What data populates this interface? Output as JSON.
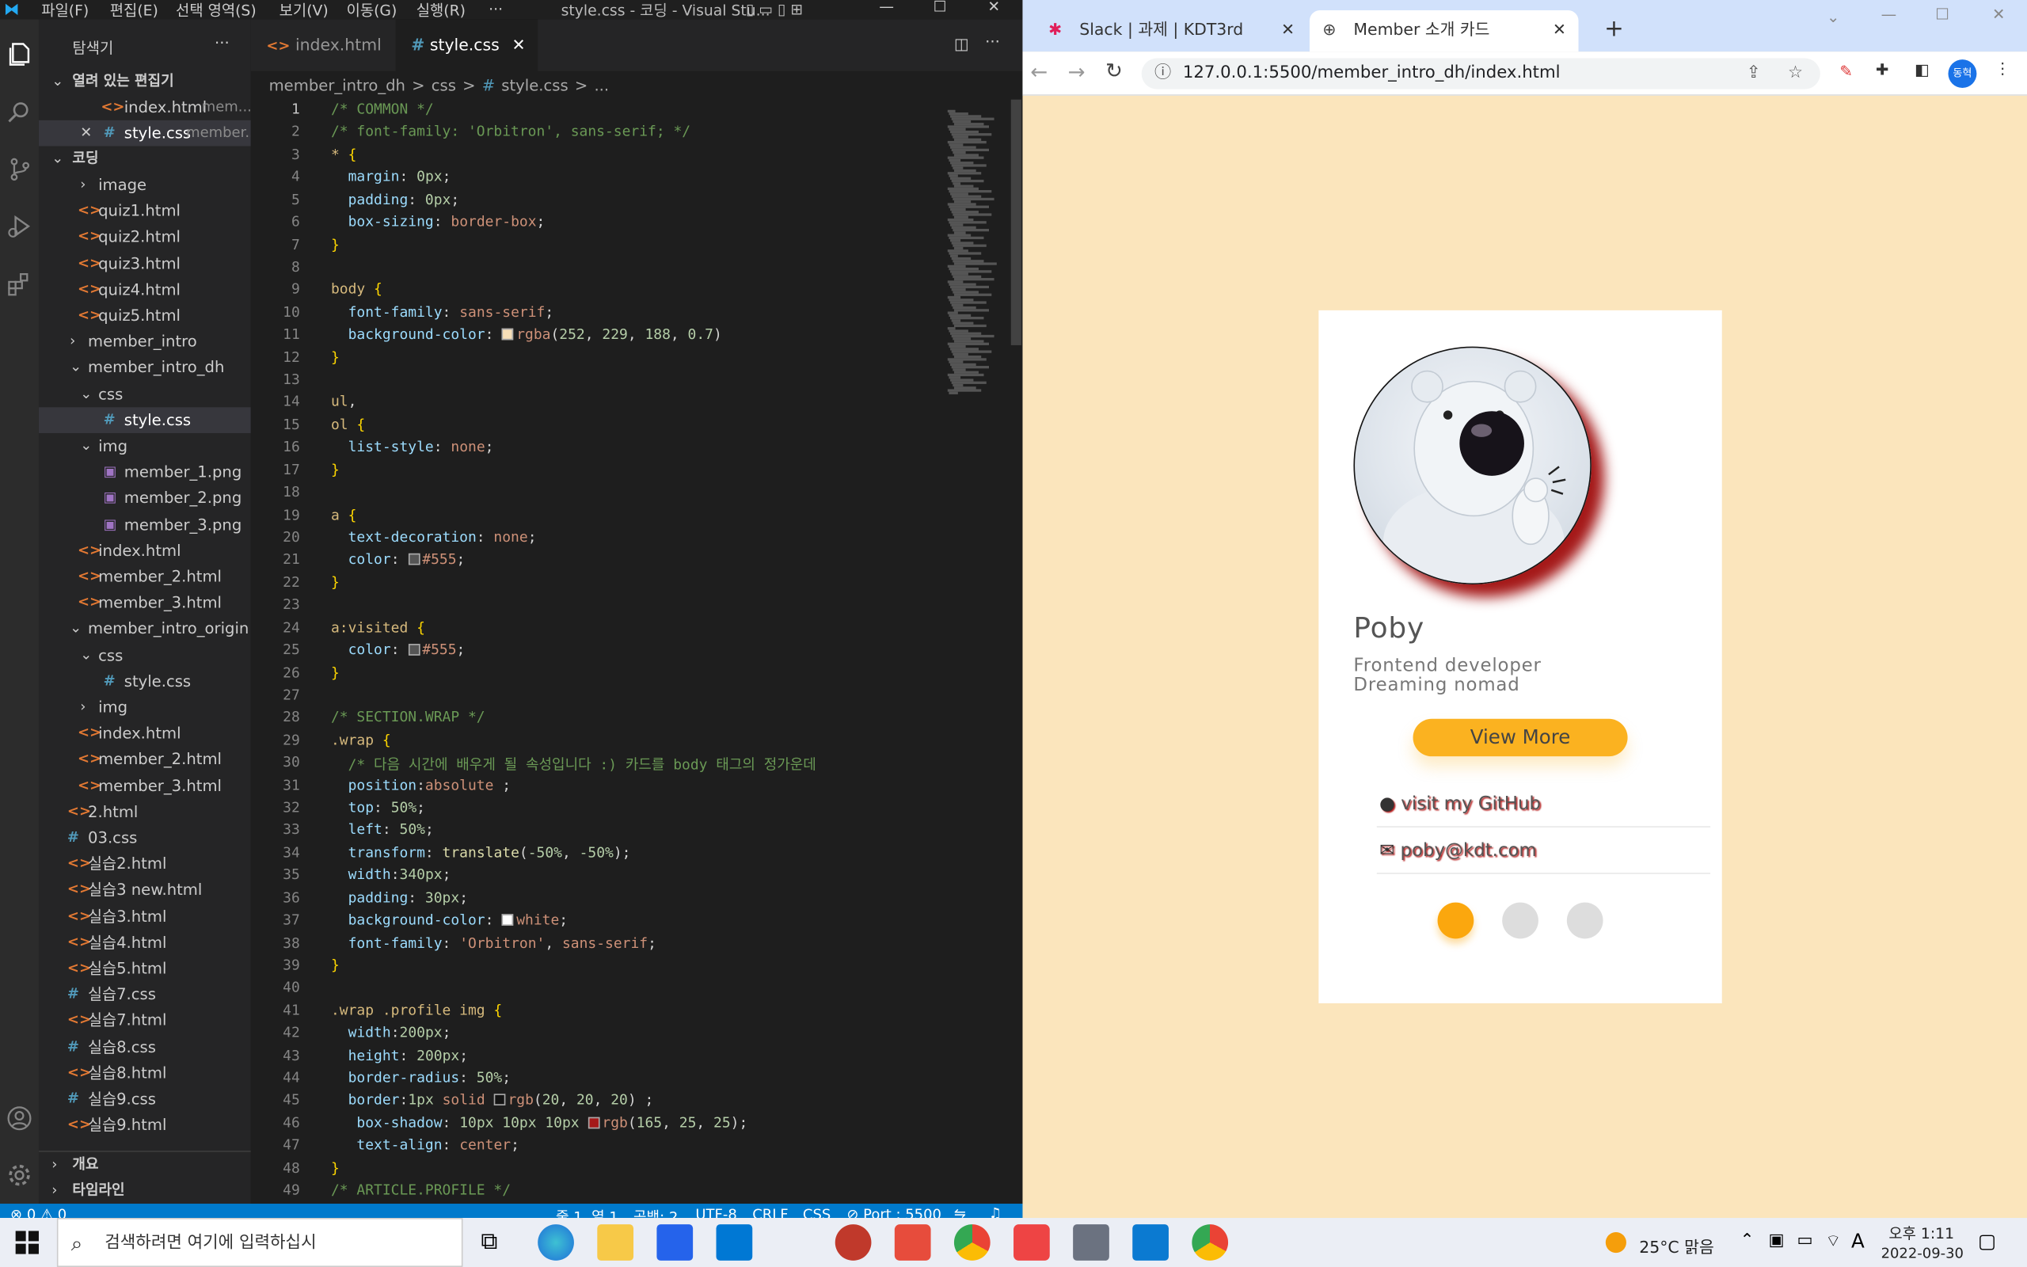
{
  "vscode": {
    "title": "style.css - 코딩 - Visual Stu...",
    "menu": [
      "파일(F)",
      "편집(E)",
      "선택 영역(S)",
      "보기(V)",
      "이동(G)",
      "실행(R)",
      "···"
    ],
    "explorer_title": "탐색기",
    "open_editors": {
      "header": "열려 있는 편집기",
      "items": [
        {
          "name": "index.html",
          "hint": "mem..."
        },
        {
          "name": "style.css",
          "hint": "member..."
        }
      ]
    },
    "workspace": "코딩",
    "tree": [
      {
        "label": "image",
        "type": "folder-closed",
        "depth": 1
      },
      {
        "label": "quiz1.html",
        "type": "html",
        "depth": 1
      },
      {
        "label": "quiz2.html",
        "type": "html",
        "depth": 1
      },
      {
        "label": "quiz3.html",
        "type": "html",
        "depth": 1
      },
      {
        "label": "quiz4.html",
        "type": "html",
        "depth": 1
      },
      {
        "label": "quiz5.html",
        "type": "html",
        "depth": 1
      },
      {
        "label": "member_intro",
        "type": "folder-closed",
        "depth": 0
      },
      {
        "label": "member_intro_dh",
        "type": "folder-open",
        "depth": 0
      },
      {
        "label": "css",
        "type": "folder-open",
        "depth": 1
      },
      {
        "label": "style.css",
        "type": "css",
        "depth": 2,
        "selected": true
      },
      {
        "label": "img",
        "type": "folder-open",
        "depth": 1
      },
      {
        "label": "member_1.png",
        "type": "img",
        "depth": 2
      },
      {
        "label": "member_2.png",
        "type": "img",
        "depth": 2
      },
      {
        "label": "member_3.png",
        "type": "img",
        "depth": 2
      },
      {
        "label": "index.html",
        "type": "html",
        "depth": 1
      },
      {
        "label": "member_2.html",
        "type": "html",
        "depth": 1
      },
      {
        "label": "member_3.html",
        "type": "html",
        "depth": 1
      },
      {
        "label": "member_intro_origin",
        "type": "folder-open",
        "depth": 0
      },
      {
        "label": "css",
        "type": "folder-open",
        "depth": 1
      },
      {
        "label": "style.css",
        "type": "css",
        "depth": 2
      },
      {
        "label": "img",
        "type": "folder-closed",
        "depth": 1
      },
      {
        "label": "index.html",
        "type": "html",
        "depth": 1
      },
      {
        "label": "member_2.html",
        "type": "html",
        "depth": 1
      },
      {
        "label": "member_3.html",
        "type": "html",
        "depth": 1
      },
      {
        "label": "2.html",
        "type": "html",
        "depth": -1
      },
      {
        "label": "03.css",
        "type": "css",
        "depth": -1
      },
      {
        "label": "실습2.html",
        "type": "html",
        "depth": -1
      },
      {
        "label": "실습3 new.html",
        "type": "html",
        "depth": -1
      },
      {
        "label": "실습3.html",
        "type": "html",
        "depth": -1
      },
      {
        "label": "실습4.html",
        "type": "html",
        "depth": -1
      },
      {
        "label": "실습5.html",
        "type": "html",
        "depth": -1
      },
      {
        "label": "실습7.css",
        "type": "css",
        "depth": -1
      },
      {
        "label": "실습7.html",
        "type": "html",
        "depth": -1
      },
      {
        "label": "실습8.css",
        "type": "css",
        "depth": -1
      },
      {
        "label": "실습8.html",
        "type": "html",
        "depth": -1
      },
      {
        "label": "실습9.css",
        "type": "css",
        "depth": -1
      },
      {
        "label": "실습9.html",
        "type": "html",
        "depth": -1
      }
    ],
    "outline": "개요",
    "timeline": "타임라인",
    "tabs": [
      {
        "label": "index.html"
      },
      {
        "label": "style.css"
      }
    ],
    "breadcrumbs": [
      "member_intro_dh",
      ">",
      "css",
      ">",
      "#",
      "style.css",
      ">",
      "..."
    ],
    "code_lines": [
      [
        [
          "c-com",
          "/* COMMON */"
        ]
      ],
      [
        [
          "c-com",
          "/* font-family: 'Orbitron', sans-serif; */"
        ]
      ],
      [
        [
          "c-sel",
          "* "
        ],
        [
          "c-brace",
          "{"
        ]
      ],
      [
        [
          "",
          "  "
        ],
        [
          "c-prop",
          "margin"
        ],
        [
          "",
          ": "
        ],
        [
          "c-num",
          "0px"
        ],
        [
          "",
          ";"
        ]
      ],
      [
        [
          "",
          "  "
        ],
        [
          "c-prop",
          "padding"
        ],
        [
          "",
          ": "
        ],
        [
          "c-num",
          "0px"
        ],
        [
          "",
          ";"
        ]
      ],
      [
        [
          "",
          "  "
        ],
        [
          "c-prop",
          "box-sizing"
        ],
        [
          "",
          ": "
        ],
        [
          "c-val",
          "border-box"
        ],
        [
          "",
          ";"
        ]
      ],
      [
        [
          "c-brace",
          "}"
        ]
      ],
      [],
      [
        [
          "c-sel",
          "body "
        ],
        [
          "c-brace",
          "{"
        ]
      ],
      [
        [
          "",
          "  "
        ],
        [
          "c-prop",
          "font-family"
        ],
        [
          "",
          ": "
        ],
        [
          "c-val",
          "sans-serif"
        ],
        [
          "",
          ";"
        ]
      ],
      [
        [
          "",
          "  "
        ],
        [
          "c-prop",
          "background-color"
        ],
        [
          "",
          ": "
        ],
        [
          "sw:#f6dfb8",
          ""
        ],
        [
          "c-val",
          "rgba"
        ],
        [
          "",
          "("
        ],
        [
          "c-num",
          "252"
        ],
        [
          "",
          ", "
        ],
        [
          "c-num",
          "229"
        ],
        [
          "",
          ", "
        ],
        [
          "c-num",
          "188"
        ],
        [
          "",
          ", "
        ],
        [
          "c-num",
          "0.7"
        ],
        [
          "",
          ")"
        ]
      ],
      [
        [
          "c-brace",
          "}"
        ]
      ],
      [],
      [
        [
          "c-sel",
          "ul"
        ],
        [
          "",
          ","
        ]
      ],
      [
        [
          "c-sel",
          "ol "
        ],
        [
          "c-brace",
          "{"
        ]
      ],
      [
        [
          "",
          "  "
        ],
        [
          "c-prop",
          "list-style"
        ],
        [
          "",
          ": "
        ],
        [
          "c-val",
          "none"
        ],
        [
          "",
          ";"
        ]
      ],
      [
        [
          "c-brace",
          "}"
        ]
      ],
      [],
      [
        [
          "c-sel",
          "a "
        ],
        [
          "c-brace",
          "{"
        ]
      ],
      [
        [
          "",
          "  "
        ],
        [
          "c-prop",
          "text-decoration"
        ],
        [
          "",
          ": "
        ],
        [
          "c-val",
          "none"
        ],
        [
          "",
          ";"
        ]
      ],
      [
        [
          "",
          "  "
        ],
        [
          "c-prop",
          "color"
        ],
        [
          "",
          ": "
        ],
        [
          "sw:#555555",
          ""
        ],
        [
          "c-val",
          "#555"
        ],
        [
          "",
          ";"
        ]
      ],
      [
        [
          "c-brace",
          "}"
        ]
      ],
      [],
      [
        [
          "c-sel",
          "a:visited "
        ],
        [
          "c-brace",
          "{"
        ]
      ],
      [
        [
          "",
          "  "
        ],
        [
          "c-prop",
          "color"
        ],
        [
          "",
          ": "
        ],
        [
          "sw:#555555",
          ""
        ],
        [
          "c-val",
          "#555"
        ],
        [
          "",
          ";"
        ]
      ],
      [
        [
          "c-brace",
          "}"
        ]
      ],
      [],
      [
        [
          "c-com",
          "/* SECTION.WRAP */"
        ]
      ],
      [
        [
          "c-sel",
          ".wrap "
        ],
        [
          "c-brace",
          "{"
        ]
      ],
      [
        [
          "",
          "  "
        ],
        [
          "c-com",
          "/* 다음 시간에 배우게 될 속성입니다 :) 카드를 body 태그의 정가운데"
        ]
      ],
      [
        [
          "",
          "  "
        ],
        [
          "c-prop",
          "position"
        ],
        [
          "",
          ":"
        ],
        [
          "c-val",
          "absolute"
        ],
        [
          "",
          " ;"
        ]
      ],
      [
        [
          "",
          "  "
        ],
        [
          "c-prop",
          "top"
        ],
        [
          "",
          ": "
        ],
        [
          "c-num",
          "50%"
        ],
        [
          "",
          ";"
        ]
      ],
      [
        [
          "",
          "  "
        ],
        [
          "c-prop",
          "left"
        ],
        [
          "",
          ": "
        ],
        [
          "c-num",
          "50%"
        ],
        [
          "",
          ";"
        ]
      ],
      [
        [
          "",
          "  "
        ],
        [
          "c-prop",
          "transform"
        ],
        [
          "",
          ": "
        ],
        [
          "c-kw",
          "translate"
        ],
        [
          "",
          "("
        ],
        [
          "c-num",
          "-50%"
        ],
        [
          "",
          ", "
        ],
        [
          "c-num",
          "-50%"
        ],
        [
          "",
          ");"
        ]
      ],
      [
        [
          "",
          "  "
        ],
        [
          "c-prop",
          "width"
        ],
        [
          "",
          ":"
        ],
        [
          "c-num",
          "340px"
        ],
        [
          "",
          ";"
        ]
      ],
      [
        [
          "",
          "  "
        ],
        [
          "c-prop",
          "padding"
        ],
        [
          "",
          ": "
        ],
        [
          "c-num",
          "30px"
        ],
        [
          "",
          ";"
        ]
      ],
      [
        [
          "",
          "  "
        ],
        [
          "c-prop",
          "background-color"
        ],
        [
          "",
          ": "
        ],
        [
          "sw:#ffffff",
          ""
        ],
        [
          "c-val",
          "white"
        ],
        [
          "",
          ";"
        ]
      ],
      [
        [
          "",
          "  "
        ],
        [
          "c-prop",
          "font-family"
        ],
        [
          "",
          ": "
        ],
        [
          "c-val",
          "'Orbitron'"
        ],
        [
          "",
          ", "
        ],
        [
          "c-val",
          "sans-serif"
        ],
        [
          "",
          ";"
        ]
      ],
      [
        [
          "c-brace",
          "}"
        ]
      ],
      [],
      [
        [
          "c-sel",
          ".wrap .profile img "
        ],
        [
          "c-brace",
          "{"
        ]
      ],
      [
        [
          "",
          "  "
        ],
        [
          "c-prop",
          "width"
        ],
        [
          "",
          ":"
        ],
        [
          "c-num",
          "200px"
        ],
        [
          "",
          ";"
        ]
      ],
      [
        [
          "",
          "  "
        ],
        [
          "c-prop",
          "height"
        ],
        [
          "",
          ": "
        ],
        [
          "c-num",
          "200px"
        ],
        [
          "",
          ";"
        ]
      ],
      [
        [
          "",
          "  "
        ],
        [
          "c-prop",
          "border-radius"
        ],
        [
          "",
          ": "
        ],
        [
          "c-num",
          "50%"
        ],
        [
          "",
          ";"
        ]
      ],
      [
        [
          "",
          "  "
        ],
        [
          "c-prop",
          "border"
        ],
        [
          "",
          ":"
        ],
        [
          "c-num",
          "1px"
        ],
        [
          "",
          " "
        ],
        [
          "c-val",
          "solid"
        ],
        [
          "",
          " "
        ],
        [
          "sw:#141414",
          ""
        ],
        [
          "c-val",
          "rgb"
        ],
        [
          "",
          "("
        ],
        [
          "c-num",
          "20"
        ],
        [
          "",
          ", "
        ],
        [
          "c-num",
          "20"
        ],
        [
          "",
          ", "
        ],
        [
          "c-num",
          "20"
        ],
        [
          "",
          ") ;"
        ]
      ],
      [
        [
          "",
          "   "
        ],
        [
          "c-prop",
          "box-shadow"
        ],
        [
          "",
          ": "
        ],
        [
          "c-num",
          "10px"
        ],
        [
          "",
          " "
        ],
        [
          "c-num",
          "10px"
        ],
        [
          "",
          " "
        ],
        [
          "c-num",
          "10px"
        ],
        [
          "",
          " "
        ],
        [
          "sw:#a51919",
          ""
        ],
        [
          "c-val",
          "rgb"
        ],
        [
          "",
          "("
        ],
        [
          "c-num",
          "165"
        ],
        [
          "",
          ", "
        ],
        [
          "c-num",
          "25"
        ],
        [
          "",
          ", "
        ],
        [
          "c-num",
          "25"
        ],
        [
          "",
          ");"
        ]
      ],
      [
        [
          "",
          "   "
        ],
        [
          "c-prop",
          "text-align"
        ],
        [
          "",
          ": "
        ],
        [
          "c-val",
          "center"
        ],
        [
          "",
          ";"
        ]
      ],
      [
        [
          "c-brace",
          "}"
        ]
      ],
      [
        [
          "c-com",
          "/* ARTICLE.PROFILE */"
        ]
      ]
    ],
    "status": {
      "errors": "⊗ 0 ⚠ 0",
      "position": "줄 1, 열 1",
      "spaces": "공백: 2",
      "encoding": "UTF-8",
      "eol": "CRLF",
      "lang": "CSS",
      "port": "⊘ Port : 5500"
    }
  },
  "browser": {
    "tabs": [
      {
        "label": "Slack | 과제 | KDT3rd"
      },
      {
        "label": "Member 소개 카드"
      }
    ],
    "url": "127.0.0.1:5500/member_intro_dh/index.html",
    "profile_initials": "동혁",
    "card": {
      "name": "Poby",
      "role1": "Frontend developer",
      "role2": "Dreaming nomad",
      "button": "View More",
      "github": "visit my GitHub",
      "email": "poby@kdt.com",
      "dots_active": 1,
      "accent": "#fbb220",
      "shadow_color": "#a51919"
    }
  },
  "taskbar": {
    "search_placeholder": "검색하려면 여기에 입력하십시",
    "weather": "25°C  맑음",
    "ime": "A",
    "time": "오후 1:11",
    "date": "2022-09-30"
  }
}
